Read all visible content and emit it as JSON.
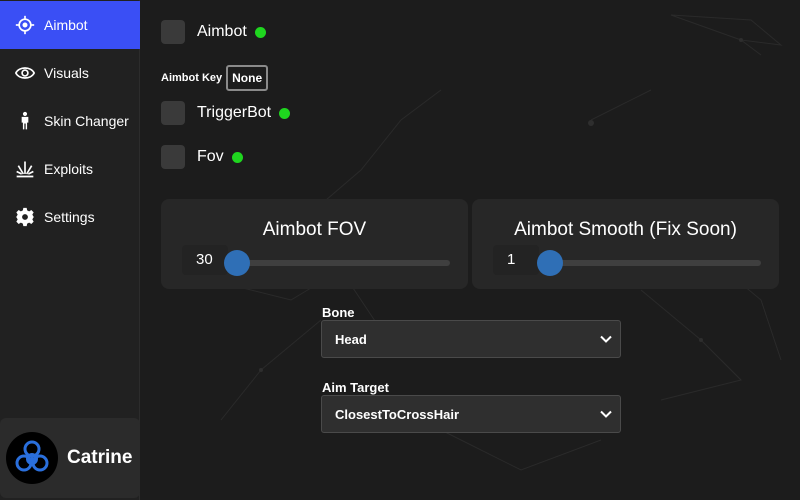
{
  "sidebar": {
    "items": [
      {
        "label": "Aimbot",
        "icon": "crosshair-icon",
        "active": true
      },
      {
        "label": "Visuals",
        "icon": "eye-icon"
      },
      {
        "label": "Skin Changer",
        "icon": "person-icon"
      },
      {
        "label": "Exploits",
        "icon": "explosion-icon"
      },
      {
        "label": "Settings",
        "icon": "gear-icon"
      }
    ],
    "profile": {
      "name": "Catrine",
      "avatar_icon": "biohazard-icon"
    }
  },
  "main": {
    "toggles": [
      {
        "label": "Aimbot",
        "status_color": "#1fd61f"
      },
      {
        "label": "TriggerBot",
        "status_color": "#1fd61f"
      },
      {
        "label": "Fov",
        "status_color": "#1fd61f"
      }
    ],
    "aimbot_key": {
      "label": "Aimbot Key",
      "value": "None"
    },
    "sliders": [
      {
        "title": "Aimbot FOV",
        "value": "30"
      },
      {
        "title": "Aimbot Smooth (Fix Soon)",
        "value": "1"
      }
    ],
    "bone": {
      "label": "Bone",
      "selected": "Head"
    },
    "aim_target": {
      "label": "Aim Target",
      "selected": "ClosestToCrossHair"
    }
  },
  "colors": {
    "accent": "#3a4ff5",
    "slider_thumb": "#2f6fb6",
    "status_dot": "#1fd61f"
  }
}
